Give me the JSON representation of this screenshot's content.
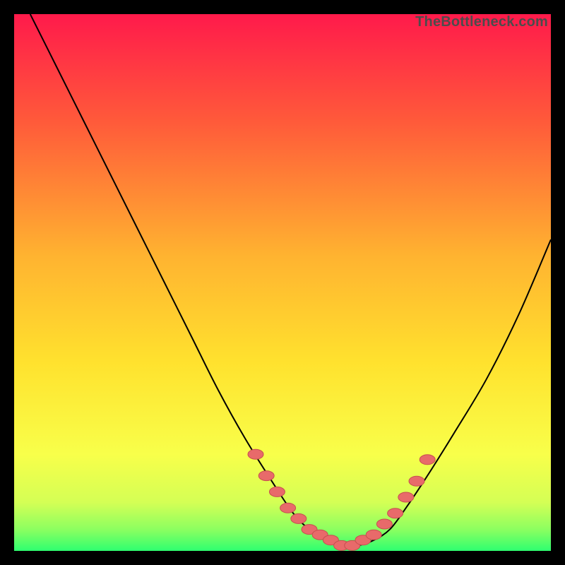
{
  "watermark": "TheBottleneck.com",
  "colors": {
    "frame": "#000000",
    "curve_stroke": "#000000",
    "marker_fill": "#e86a6a",
    "marker_stroke": "#c64f4f"
  },
  "chart_data": {
    "type": "line",
    "title": "",
    "xlabel": "",
    "ylabel": "",
    "xlim": [
      0,
      100
    ],
    "ylim": [
      0,
      100
    ],
    "gradient_stops": [
      {
        "offset": 0.0,
        "color": "#ff1a4b"
      },
      {
        "offset": 0.2,
        "color": "#ff5a3a"
      },
      {
        "offset": 0.45,
        "color": "#ffb330"
      },
      {
        "offset": 0.65,
        "color": "#ffe22e"
      },
      {
        "offset": 0.82,
        "color": "#f8ff4a"
      },
      {
        "offset": 0.91,
        "color": "#d4ff55"
      },
      {
        "offset": 0.96,
        "color": "#8cff60"
      },
      {
        "offset": 1.0,
        "color": "#2eff70"
      }
    ],
    "series": [
      {
        "name": "bottleneck-curve",
        "x": [
          3,
          8,
          13,
          18,
          23,
          28,
          33,
          38,
          43,
          48,
          52,
          55,
          58,
          61,
          64,
          67,
          70,
          73,
          77,
          82,
          88,
          94,
          100
        ],
        "y": [
          100,
          90,
          80,
          70,
          60,
          50,
          40,
          30,
          21,
          13,
          7,
          4,
          2,
          1,
          1,
          2,
          4,
          8,
          14,
          22,
          32,
          44,
          58
        ]
      }
    ],
    "markers": {
      "name": "highlighted-points",
      "x": [
        45,
        47,
        49,
        51,
        53,
        55,
        57,
        59,
        61,
        63,
        65,
        67,
        69,
        71,
        73,
        75,
        77
      ],
      "y": [
        18,
        14,
        11,
        8,
        6,
        4,
        3,
        2,
        1,
        1,
        2,
        3,
        5,
        7,
        10,
        13,
        17
      ]
    }
  }
}
